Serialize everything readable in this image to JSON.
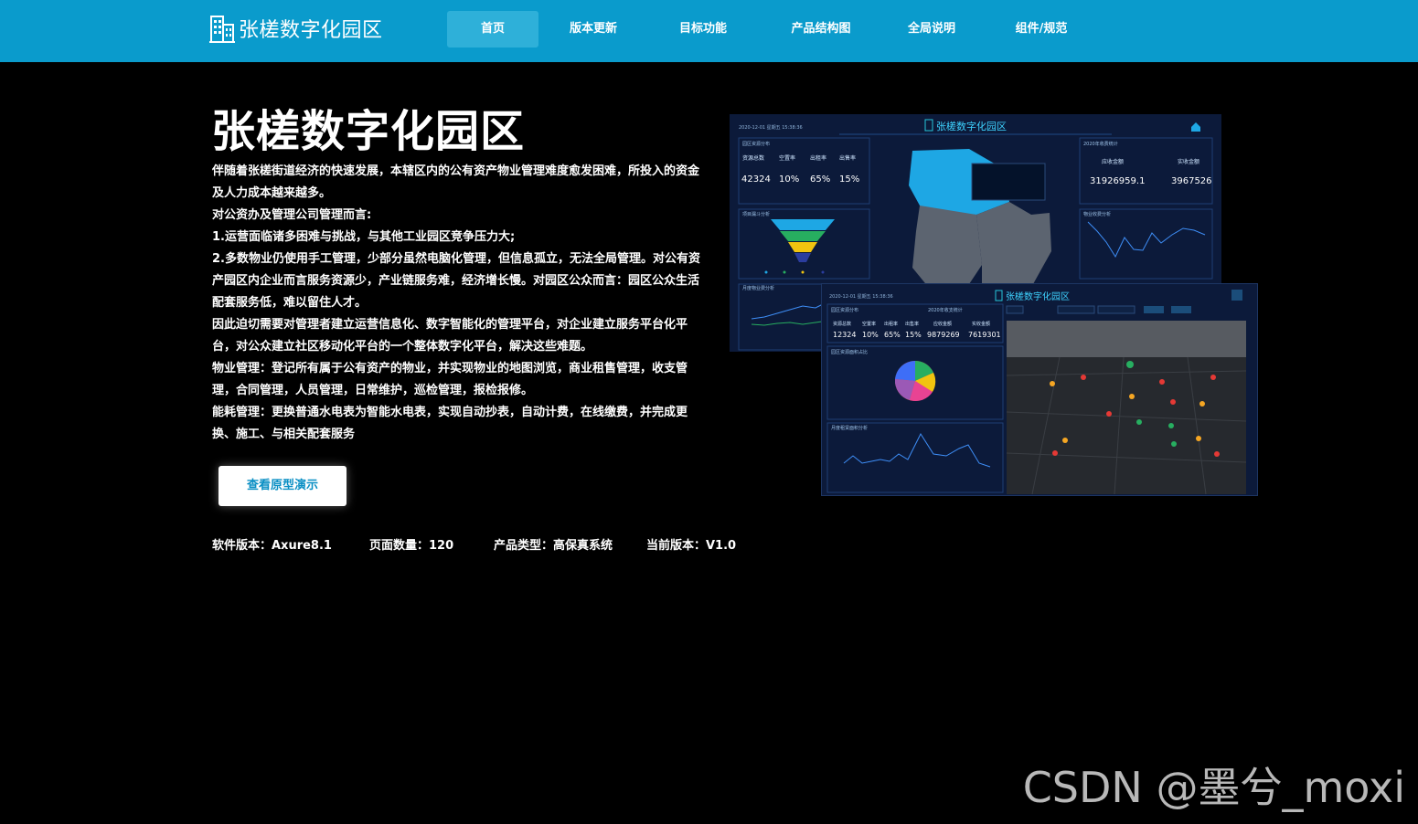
{
  "header": {
    "brand": "张槎数字化园区",
    "nav": [
      {
        "label": "首页"
      },
      {
        "label": "版本更新"
      },
      {
        "label": "目标功能"
      },
      {
        "label": "产品结构图"
      },
      {
        "label": "全局说明"
      },
      {
        "label": "组件/规范"
      }
    ],
    "active_index": 0
  },
  "hero": {
    "title": "张槎数字化园区",
    "paragraphs": [
      "伴随着张槎街道经济的快速发展，本辖区内的公有资产物业管理难度愈发困难，所投入的资金及人力成本越来越多。",
      "对公资办及管理公司管理而言:",
      "1.运营面临诸多困难与挑战，与其他工业园区竞争压力大;",
      "2.多数物业仍使用手工管理，少部分虽然电脑化管理，但信息孤立，无法全局管理。对公有资产园区内企业而言服务资源少，产业链服务难，经济增长慢。对园区公众而言：园区公众生活配套服务低，难以留住人才。",
      "因此迫切需要对管理者建立运营信息化、数字智能化的管理平台，对企业建立服务平台化平台，对公众建立社区移动化平台的一个整体数字化平台，解决这些难题。",
      "物业管理：登记所有属于公有资产的物业，并实现物业的地图浏览，商业租售管理，收支管理，合同管理，人员管理，日常维护，巡检管理，报检报修。",
      "能耗管理：更换普通水电表为智能水电表，实现自动抄表，自动计费，在线缴费，并完成更换、施工、与相关配套服务"
    ],
    "demo_button": "查看原型演示"
  },
  "meta": {
    "software": "软件版本：Axure8.1",
    "pages": "页面数量：120",
    "type": "产品类型：高保真系统",
    "version": "当前版本：V1.0"
  },
  "preview1": {
    "title": "张槎数字化园区",
    "date": "2020-12-01  星期五  15:38:36",
    "stat_labels": [
      "资源总数",
      "空置率",
      "出租率",
      "出售率"
    ],
    "stat_values": [
      "42324",
      "10%",
      "65%",
      "15%"
    ],
    "money_labels": [
      "应收金额",
      "实收金额"
    ],
    "money_values": [
      "31926959.1",
      "3967526"
    ],
    "panel_titles": [
      "园区资源分布",
      "项目漏斗分析",
      "2020年收费统计",
      "物业收费分析",
      "月度物业费分析"
    ]
  },
  "preview2": {
    "title": "张槎数字化园区",
    "date": "2020-12-01  星期五  15:38:36",
    "stat_labels": [
      "资源总数",
      "空置率",
      "出租率",
      "出售率",
      "应收金额",
      "实收金额"
    ],
    "stat_values": [
      "12324",
      "10%",
      "65%",
      "15%",
      "9879269",
      "7619301"
    ],
    "panel_titles": [
      "园区资源分布",
      "2020年收支统计",
      "园区资源面积占比",
      "月度租赁面积分析"
    ]
  },
  "watermark": "CSDN @墨兮_moxi",
  "colors": {
    "header": "#0a9bcc",
    "nav_active": "#2eb0d9",
    "button_text": "#0a8fc4",
    "preview_bg": "#0c1a3a",
    "accent": "#1ea7e4"
  }
}
